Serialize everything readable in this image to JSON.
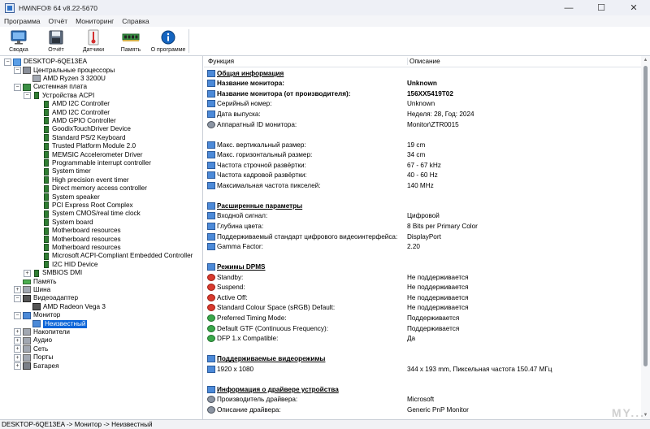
{
  "window": {
    "title": "HWiNFO® 64 v8.22-5670",
    "minimize": "—",
    "maximize": "☐",
    "close": "✕"
  },
  "menu": [
    "Программа",
    "Отчёт",
    "Мониторинг",
    "Справка"
  ],
  "toolbar": [
    {
      "label": "Сводка",
      "icon": "monitor-icon"
    },
    {
      "label": "Отчёт",
      "icon": "save-icon"
    },
    {
      "label": "Датчики",
      "icon": "thermometer-icon"
    },
    {
      "label": "Память",
      "icon": "memory-icon"
    },
    {
      "label": "О программе",
      "icon": "info-icon"
    }
  ],
  "tree": [
    {
      "label": "DESKTOP-6QE13EA",
      "depth": 0,
      "toggle": "−",
      "icon": "comp"
    },
    {
      "label": "Центральные процессоры",
      "depth": 1,
      "toggle": "−",
      "icon": "cpu"
    },
    {
      "label": "AMD Ryzen 3 3200U",
      "depth": 2,
      "toggle": "",
      "icon": "grey"
    },
    {
      "label": "Системная плата",
      "depth": 1,
      "toggle": "−",
      "icon": "mb"
    },
    {
      "label": "Устройства ACPI",
      "depth": 2,
      "toggle": "−",
      "icon": "chip"
    },
    {
      "label": "AMD I2C Controller",
      "depth": 3,
      "toggle": "",
      "icon": "chip"
    },
    {
      "label": "AMD I2C Controller",
      "depth": 3,
      "toggle": "",
      "icon": "chip"
    },
    {
      "label": "AMD GPIO Controller",
      "depth": 3,
      "toggle": "",
      "icon": "chip"
    },
    {
      "label": "GoodixTouchDriver Device",
      "depth": 3,
      "toggle": "",
      "icon": "chip"
    },
    {
      "label": "Standard PS/2 Keyboard",
      "depth": 3,
      "toggle": "",
      "icon": "chip"
    },
    {
      "label": "Trusted Platform Module 2.0",
      "depth": 3,
      "toggle": "",
      "icon": "chip"
    },
    {
      "label": "MEMSIC Accelerometer Driver",
      "depth": 3,
      "toggle": "",
      "icon": "chip"
    },
    {
      "label": "Programmable interrupt controller",
      "depth": 3,
      "toggle": "",
      "icon": "chip"
    },
    {
      "label": "System timer",
      "depth": 3,
      "toggle": "",
      "icon": "chip"
    },
    {
      "label": "High precision event timer",
      "depth": 3,
      "toggle": "",
      "icon": "chip"
    },
    {
      "label": "Direct memory access controller",
      "depth": 3,
      "toggle": "",
      "icon": "chip"
    },
    {
      "label": "System speaker",
      "depth": 3,
      "toggle": "",
      "icon": "chip"
    },
    {
      "label": "PCI Express Root Complex",
      "depth": 3,
      "toggle": "",
      "icon": "chip"
    },
    {
      "label": "System CMOS/real time clock",
      "depth": 3,
      "toggle": "",
      "icon": "chip"
    },
    {
      "label": "System board",
      "depth": 3,
      "toggle": "",
      "icon": "chip"
    },
    {
      "label": "Motherboard resources",
      "depth": 3,
      "toggle": "",
      "icon": "chip"
    },
    {
      "label": "Motherboard resources",
      "depth": 3,
      "toggle": "",
      "icon": "chip"
    },
    {
      "label": "Motherboard resources",
      "depth": 3,
      "toggle": "",
      "icon": "chip"
    },
    {
      "label": "Microsoft ACPI-Compliant Embedded Controller",
      "depth": 3,
      "toggle": "",
      "icon": "chip"
    },
    {
      "label": "I2C HID Device",
      "depth": 3,
      "toggle": "",
      "icon": "chip"
    },
    {
      "label": "SMBIOS DMI",
      "depth": 2,
      "toggle": "+",
      "icon": "chip"
    },
    {
      "label": "Память",
      "depth": 1,
      "toggle": "",
      "icon": "ram"
    },
    {
      "label": "Шина",
      "depth": 1,
      "toggle": "+",
      "icon": "grey"
    },
    {
      "label": "Видеоадаптер",
      "depth": 1,
      "toggle": "−",
      "icon": "gpu"
    },
    {
      "label": "AMD Radeon Vega 3",
      "depth": 2,
      "toggle": "",
      "icon": "gpu"
    },
    {
      "label": "Монитор",
      "depth": 1,
      "toggle": "−",
      "icon": "mon"
    },
    {
      "label": "Неизвестный",
      "depth": 2,
      "toggle": "",
      "icon": "mon",
      "selected": true
    },
    {
      "label": "Накопители",
      "depth": 1,
      "toggle": "+",
      "icon": "grey"
    },
    {
      "label": "Аудио",
      "depth": 1,
      "toggle": "+",
      "icon": "grey"
    },
    {
      "label": "Сеть",
      "depth": 1,
      "toggle": "+",
      "icon": "grey"
    },
    {
      "label": "Порты",
      "depth": 1,
      "toggle": "+",
      "icon": "grey"
    },
    {
      "label": "Батарея",
      "depth": 1,
      "toggle": "+",
      "icon": "bat"
    }
  ],
  "details": {
    "col_feature": "Функция",
    "col_description": "Описание",
    "rows": [
      {
        "type": "section",
        "name": "Общая информация",
        "value": "",
        "icon": "secicon"
      },
      {
        "type": "bold",
        "name": "Название монитора:",
        "value": "Unknown",
        "icon": "blue"
      },
      {
        "type": "bold",
        "name": "Название монитора (от производителя):",
        "value": "156XX5419T02",
        "icon": "blue"
      },
      {
        "type": "row",
        "name": "Серийный номер:",
        "value": "Unknown",
        "icon": "blue"
      },
      {
        "type": "row",
        "name": "Дата выпуска:",
        "value": "Неделя: 28, Год: 2024",
        "icon": "blue"
      },
      {
        "type": "row",
        "name": "Аппаратный ID монитора:",
        "value": "Monitor\\ZTR0015",
        "icon": "gear"
      },
      {
        "type": "blank",
        "name": "",
        "value": "",
        "icon": ""
      },
      {
        "type": "row",
        "name": "Макс. вертикальный размер:",
        "value": "19 cm",
        "icon": "blue"
      },
      {
        "type": "row",
        "name": "Макс. горизонтальный размер:",
        "value": "34 cm",
        "icon": "blue"
      },
      {
        "type": "row",
        "name": "Частота строчной развёртки:",
        "value": "67 - 67 kHz",
        "icon": "blue"
      },
      {
        "type": "row",
        "name": "Частота кадровой развёртки:",
        "value": "40 - 60 Hz",
        "icon": "blue"
      },
      {
        "type": "row",
        "name": "Максимальная частота пикселей:",
        "value": "140 MHz",
        "icon": "blue"
      },
      {
        "type": "blank",
        "name": "",
        "value": "",
        "icon": ""
      },
      {
        "type": "section",
        "name": "Расширенные параметры",
        "value": "",
        "icon": "secicon"
      },
      {
        "type": "row",
        "name": "Входной сигнал:",
        "value": "Цифровой",
        "icon": "blue"
      },
      {
        "type": "row",
        "name": "Глубина цвета:",
        "value": "8 Bits per Primary Color",
        "icon": "blue"
      },
      {
        "type": "row",
        "name": "Поддерживаемый стандарт цифрового видеоинтерфейса:",
        "value": "DisplayPort",
        "icon": "blue"
      },
      {
        "type": "row",
        "name": "Gamma Factor:",
        "value": "2.20",
        "icon": "blue"
      },
      {
        "type": "blank",
        "name": "",
        "value": "",
        "icon": ""
      },
      {
        "type": "section",
        "name": "Режимы DPMS",
        "value": "",
        "icon": "secicon"
      },
      {
        "type": "row",
        "name": "Standby:",
        "value": "Не поддерживается",
        "icon": "red"
      },
      {
        "type": "row",
        "name": "Suspend:",
        "value": "Не поддерживается",
        "icon": "red"
      },
      {
        "type": "row",
        "name": "Active Off:",
        "value": "Не поддерживается",
        "icon": "red"
      },
      {
        "type": "row",
        "name": "Standard Colour Space (sRGB) Default:",
        "value": "Не поддерживается",
        "icon": "red"
      },
      {
        "type": "row",
        "name": "Preferred Timing Mode:",
        "value": "Поддерживается",
        "icon": "green"
      },
      {
        "type": "row",
        "name": "Default GTF (Continuous Frequency):",
        "value": "Поддерживается",
        "icon": "green"
      },
      {
        "type": "row",
        "name": "DFP 1.x Compatible:",
        "value": "Да",
        "icon": "green"
      },
      {
        "type": "blank",
        "name": "",
        "value": "",
        "icon": ""
      },
      {
        "type": "section",
        "name": "Поддерживаемые видеорежимы",
        "value": "",
        "icon": "secicon"
      },
      {
        "type": "row",
        "name": "1920 x 1080",
        "value": "344 x 193 mm, Пиксельная частота 150.47 МГц",
        "icon": "blue"
      },
      {
        "type": "blank",
        "name": "",
        "value": "",
        "icon": ""
      },
      {
        "type": "section",
        "name": "Информация о драйвере устройства",
        "value": "",
        "icon": "secicon"
      },
      {
        "type": "row",
        "name": "Производитель драйвера:",
        "value": "Microsoft",
        "icon": "gear"
      },
      {
        "type": "row",
        "name": "Описание драйвера:",
        "value": "Generic PnP Monitor",
        "icon": "gear"
      }
    ]
  },
  "status": {
    "path": "DESKTOP-6QE13EA -> Монитор -> Неизвестный"
  },
  "watermark": "MY..."
}
